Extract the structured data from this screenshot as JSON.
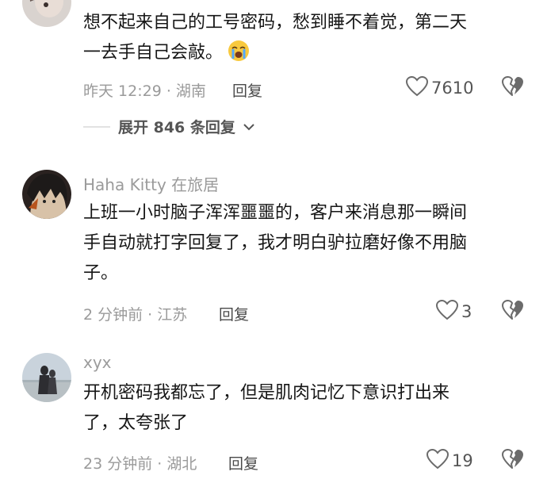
{
  "comments": [
    {
      "username": "",
      "lines": [
        "想不起来自己的工号密码，愁到睡不着觉，第二天",
        "一去手自己会敲。"
      ],
      "emoji": "crying-face",
      "time": "昨天 12:29",
      "location": "湖南",
      "meta": "昨天 12:29 · 湖南",
      "reply_label": "回复",
      "likes": "7610"
    },
    {
      "username": "Haha Kitty 在旅居",
      "lines": [
        "上班一小时脑子浑浑噩噩的，客户来消息那一瞬间",
        "手自动就打字回复了，我才明白驴拉磨好像不用脑",
        "子。"
      ],
      "meta": "2 分钟前 · 江苏",
      "reply_label": "回复",
      "likes": "3"
    },
    {
      "username": "xyx",
      "lines": [
        "开机密码我都忘了，但是肌肉记忆下意识打出来",
        "了，太夸张了"
      ],
      "meta": "23 分钟前 · 湖北",
      "reply_label": "回复",
      "likes": "19"
    }
  ],
  "expand_replies": {
    "label": "展开 846 条回复"
  },
  "icons": {
    "like": "heart-outline-icon",
    "dislike": "broken-heart-icon",
    "expand": "chevron-down-icon"
  },
  "colors": {
    "text": "#161616",
    "meta": "#9a9a9a",
    "username": "#9b9b9b",
    "icon": "#6b6b6b"
  }
}
